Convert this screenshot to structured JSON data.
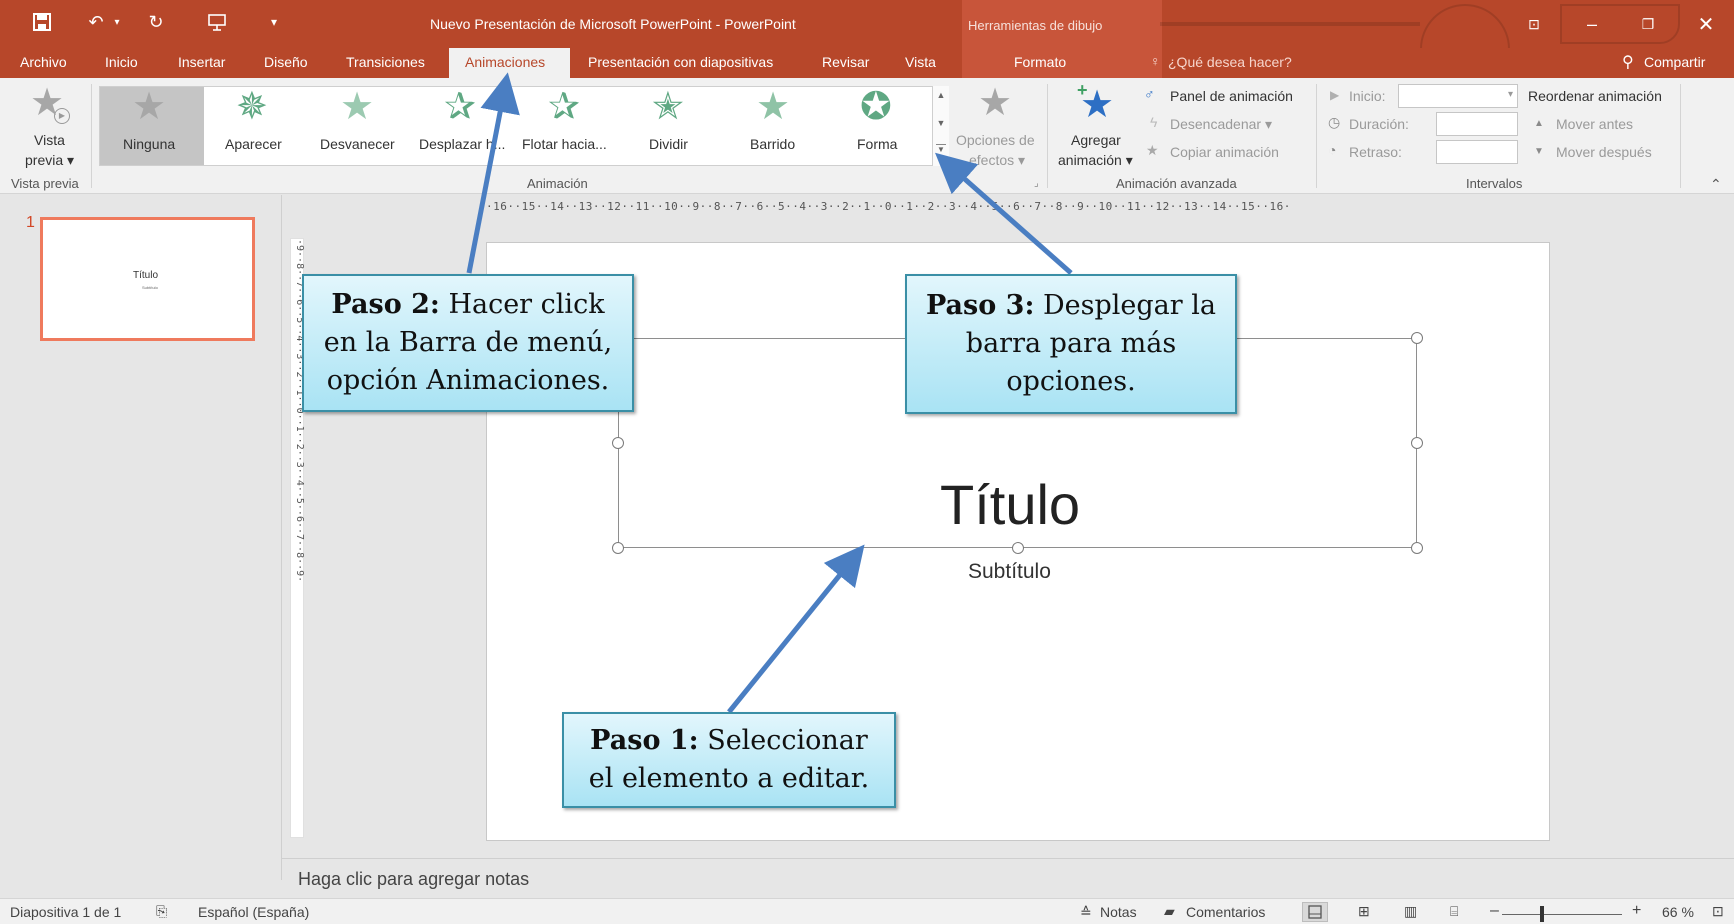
{
  "window": {
    "title": "Nuevo Presentación de Microsoft PowerPoint - PowerPoint",
    "context_tab_group": "Herramientas de dibujo"
  },
  "menu": {
    "items": [
      "Archivo",
      "Inicio",
      "Insertar",
      "Diseño",
      "Transiciones",
      "Animaciones",
      "Presentación con diapositivas",
      "Revisar",
      "Vista"
    ],
    "active": "Animaciones",
    "formato": "Formato",
    "search": "¿Qué desea hacer?",
    "share": "Compartir"
  },
  "ribbon": {
    "preview": {
      "label_line1": "Vista",
      "label_line2": "previa ▾",
      "group": "Vista previa"
    },
    "animation_gallery": {
      "items": [
        "Ninguna",
        "Aparecer",
        "Desvanecer",
        "Desplazar h...",
        "Flotar hacia...",
        "Dividir",
        "Barrido",
        "Forma"
      ],
      "selected": "Ninguna",
      "group": "Animación"
    },
    "effect_options": {
      "line1": "Opciones de",
      "line2": "efectos ▾"
    },
    "advanced": {
      "add_line1": "Agregar",
      "add_line2": "animación ▾",
      "panel": "Panel de animación",
      "trigger": "Desencadenar ▾",
      "copy": "Copiar animación",
      "group": "Animación avanzada"
    },
    "timing": {
      "start": "Inicio:",
      "duration": "Duración:",
      "delay": "Retraso:",
      "group": "Intervalos"
    },
    "reorder": {
      "title": "Reordenar animación",
      "earlier": "Mover antes",
      "later": "Mover después"
    }
  },
  "thumbnails": {
    "number": "1",
    "title": "Título",
    "subtitle": "Subtítulo"
  },
  "ruler": {
    "horizontal": "·16··15··14··13··12··11··10··9··8··7··6··5··4··3··2··1··0··1··2··3··4··5··6··7··8··9··10··11··12··13··14··15··16·",
    "vertical": "·9··8··7··6··5··4··3··2··1··0··1··2··3··4··5··6··7··8··9·"
  },
  "slide": {
    "title": "Título",
    "subtitle": "Subtítulo"
  },
  "notes_placeholder": "Haga clic para agregar notas",
  "statusbar": {
    "slide_info": "Diapositiva 1 de 1",
    "language": "Español (España)",
    "notes": "Notas",
    "comments": "Comentarios",
    "zoom": "66 %"
  },
  "callouts": {
    "step1": {
      "bold": "Paso 1:",
      "text": " Seleccionar el elemento a editar."
    },
    "step2": {
      "bold": "Paso 2:",
      "text": " Hacer click en la Barra de menú, opción Animaciones."
    },
    "step3": {
      "bold": "Paso 3:",
      "text": " Desplegar la barra para más opciones."
    }
  },
  "colors": {
    "accent": "#b7472a",
    "callout_fill": "#a9e3f4",
    "arrow": "#4a7ec2"
  }
}
